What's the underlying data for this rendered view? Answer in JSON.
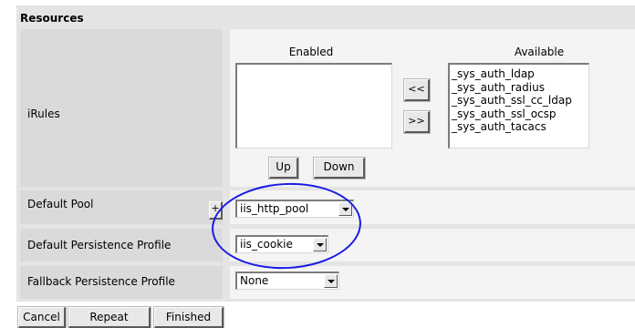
{
  "section": {
    "title": "Resources"
  },
  "irules": {
    "label": "iRules",
    "enabled_header": "Enabled",
    "available_header": "Available",
    "enabled_items": [],
    "available_items": [
      "_sys_auth_ldap",
      "_sys_auth_radius",
      "_sys_auth_ssl_cc_ldap",
      "_sys_auth_ssl_ocsp",
      "_sys_auth_tacacs"
    ],
    "move_left_label": "<<",
    "move_right_label": ">>",
    "up_label": "Up",
    "down_label": "Down"
  },
  "default_pool": {
    "label": "Default Pool",
    "value": "iis_http_pool",
    "add_label": "+"
  },
  "default_persistence": {
    "label": "Default Persistence Profile",
    "value": "iis_cookie"
  },
  "fallback_persistence": {
    "label": "Fallback Persistence Profile",
    "value": "None"
  },
  "footer": {
    "cancel": "Cancel",
    "repeat": "Repeat",
    "finished": "Finished"
  },
  "colors": {
    "panel": "#e4e4e4",
    "label_cell": "#dadada",
    "value_cell": "#f4f4f4",
    "callout": "#1a1ae6"
  }
}
